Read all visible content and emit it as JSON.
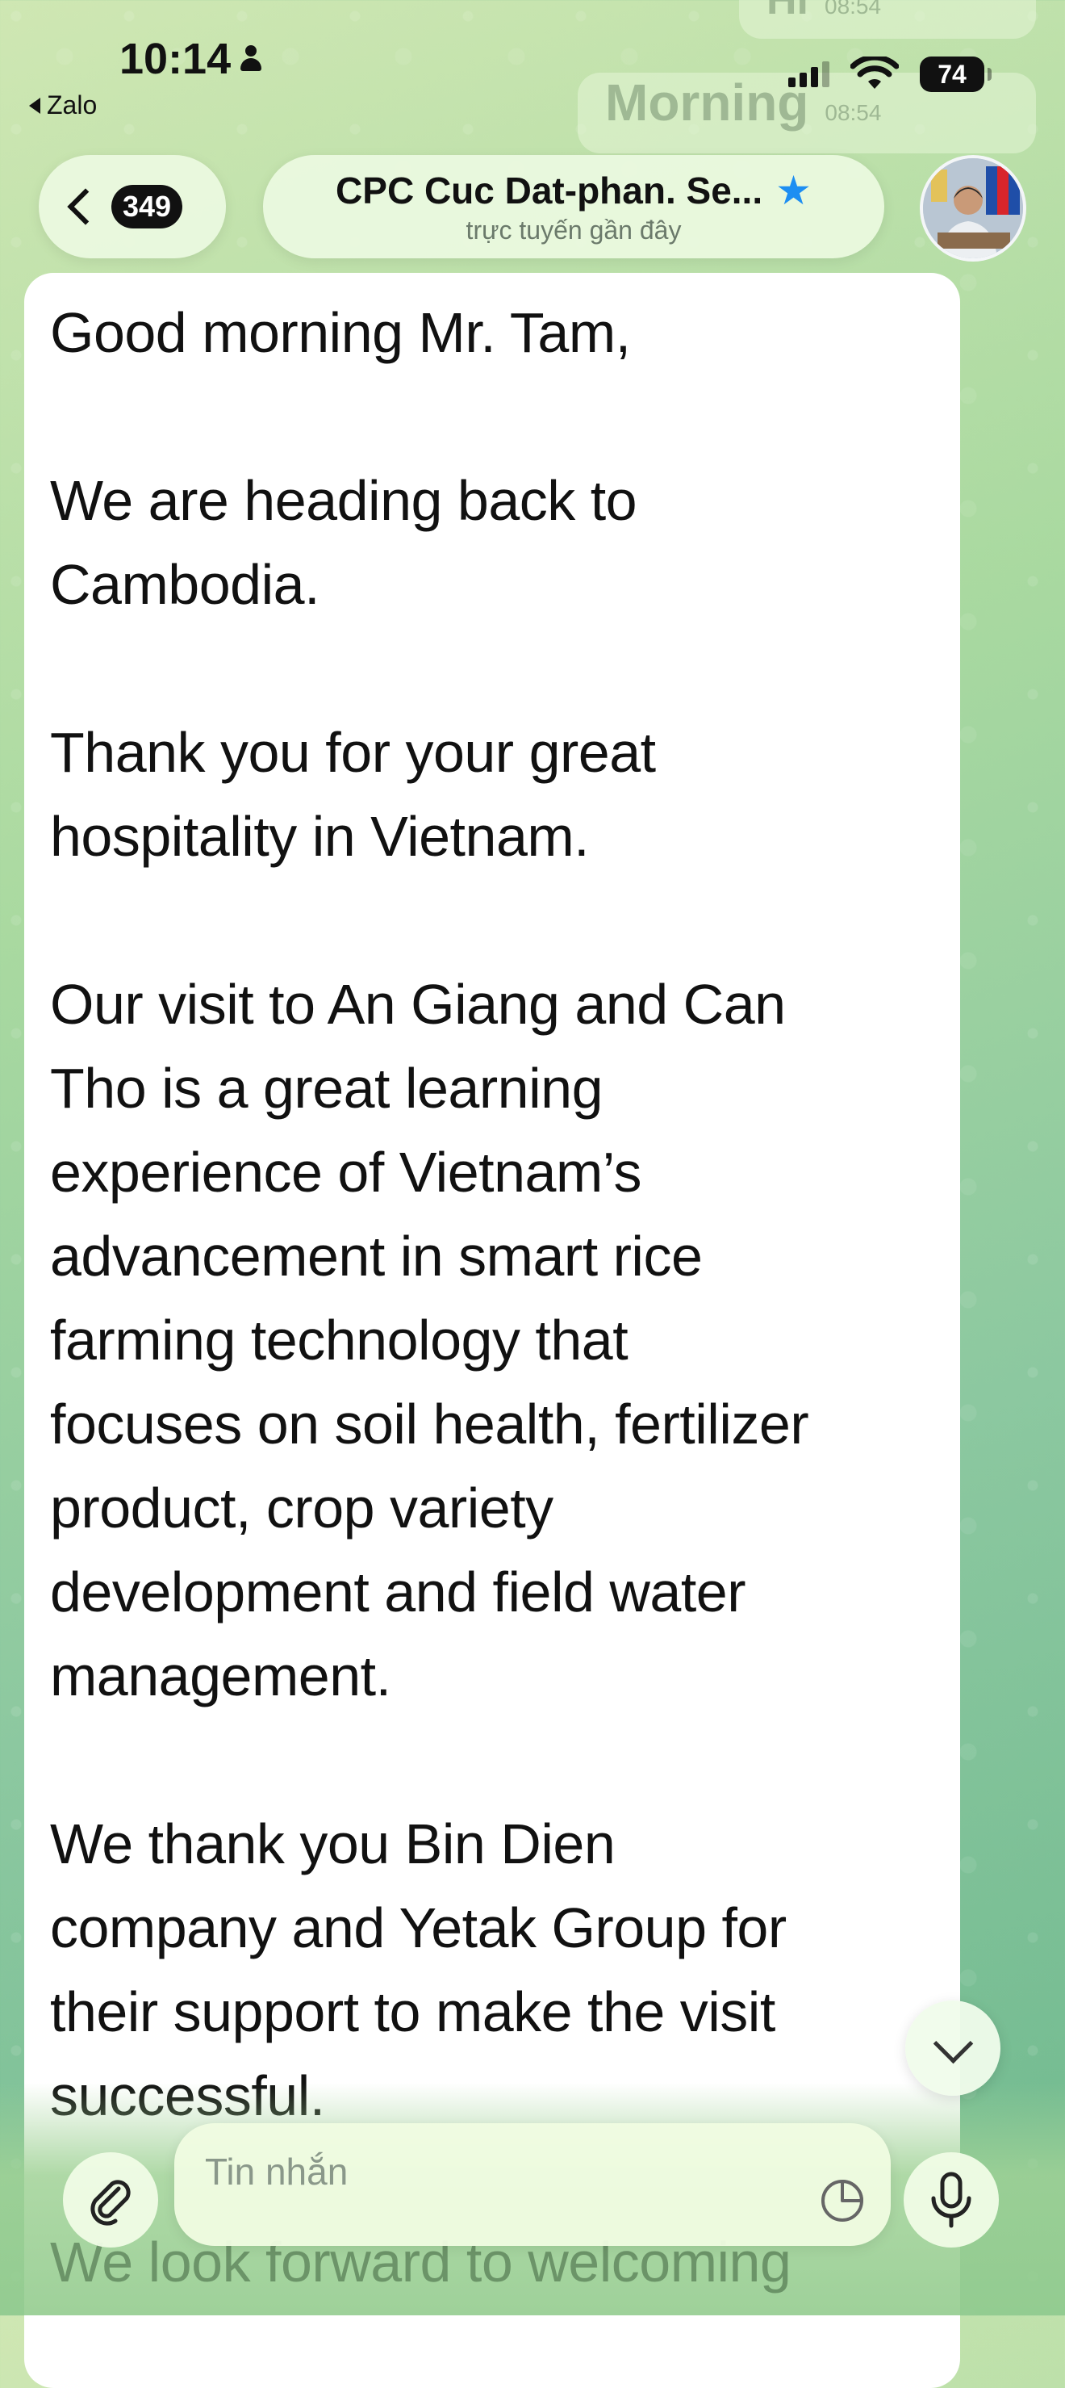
{
  "status_bar": {
    "time": "10:14",
    "back_app": "Zalo",
    "battery": "74"
  },
  "background_messages": [
    {
      "text": "Hi",
      "time": "08:54"
    },
    {
      "text": "Morning",
      "time": "08:54"
    }
  ],
  "header": {
    "unread_count": "349",
    "title": "CPC Cuc Dat-phan. Se...",
    "subtitle": "trực tuyến gần đây",
    "starred": true
  },
  "message": {
    "paragraphs": [
      "Good morning Mr. Tam,",
      "We are heading back to\nCambodia.",
      "Thank you for your great\nhospitality in Vietnam.",
      "Our visit to An Giang and Can\nTho is a great learning\nexperience of Vietnam’s\nadvancement in smart rice\nfarming technology that\nfocuses on soil health, fertilizer\nproduct, crop variety\ndevelopment and field water\nmanagement.",
      "We thank you Bin Dien\ncompany and Yetak Group for\ntheir support to make the visit\nsuccessful.",
      "We look forward to welcoming"
    ]
  },
  "composer": {
    "placeholder": "Tin nhắn"
  },
  "colors": {
    "accent_star": "#1d8ef2",
    "bubble": "#ffffff",
    "header_pill": "#ebfae1"
  },
  "icons": [
    "person-icon",
    "signal-icon",
    "wifi-icon",
    "battery-icon",
    "chevron-left-icon",
    "star-icon",
    "chevron-down-icon",
    "paperclip-icon",
    "sticker-icon",
    "microphone-icon"
  ]
}
